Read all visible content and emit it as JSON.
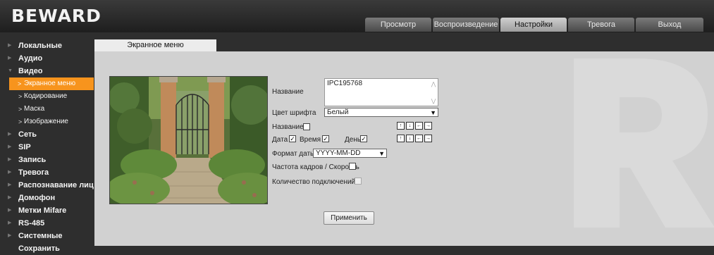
{
  "header": {
    "logo": "BEWARD",
    "tabs": [
      {
        "label": "Просмотр"
      },
      {
        "label": "Воспроизведение"
      },
      {
        "label": "Настройки"
      },
      {
        "label": "Тревога"
      },
      {
        "label": "Выход"
      }
    ],
    "active_tab": "Настройки"
  },
  "sidebar": {
    "items": [
      {
        "label": "Локальные"
      },
      {
        "label": "Аудио"
      },
      {
        "label": "Видео"
      },
      {
        "label": "Экранное меню"
      },
      {
        "label": "Кодирование"
      },
      {
        "label": "Маска"
      },
      {
        "label": "Изображение"
      },
      {
        "label": "Сеть"
      },
      {
        "label": "SIP"
      },
      {
        "label": "Запись"
      },
      {
        "label": "Тревога"
      },
      {
        "label": "Распознавание лиц"
      },
      {
        "label": "Домофон"
      },
      {
        "label": "Метки Mifare"
      },
      {
        "label": "RS-485"
      },
      {
        "label": "Системные"
      },
      {
        "label": "Сохранить"
      }
    ],
    "selected": "Экранное меню"
  },
  "content_tab": {
    "label": "Экранное меню"
  },
  "form": {
    "name_label": "Название",
    "name_value": "IPC195768",
    "font_color_label": "Цвет шрифта",
    "font_color_value": "Белый",
    "show_name_label": "Название",
    "show_name_checked": false,
    "date_label": "Дата",
    "date_checked": true,
    "time_label": "Время",
    "time_checked": true,
    "day_label": "День",
    "day_checked": true,
    "date_format_label": "Формат даты",
    "date_format_value": "YYYY-MM-DD",
    "framerate_label": "Частота кадров / Скорость",
    "framerate_checked": false,
    "connections_label": "Количество подключений",
    "connections_checked": false,
    "apply_label": "Применить",
    "position_arrows": [
      "↑",
      "↓",
      "←",
      "→"
    ]
  },
  "colors": {
    "header_bg": "#2e2e2e",
    "content_bg": "#d1d1d1",
    "selected_item": "#f7941d"
  }
}
